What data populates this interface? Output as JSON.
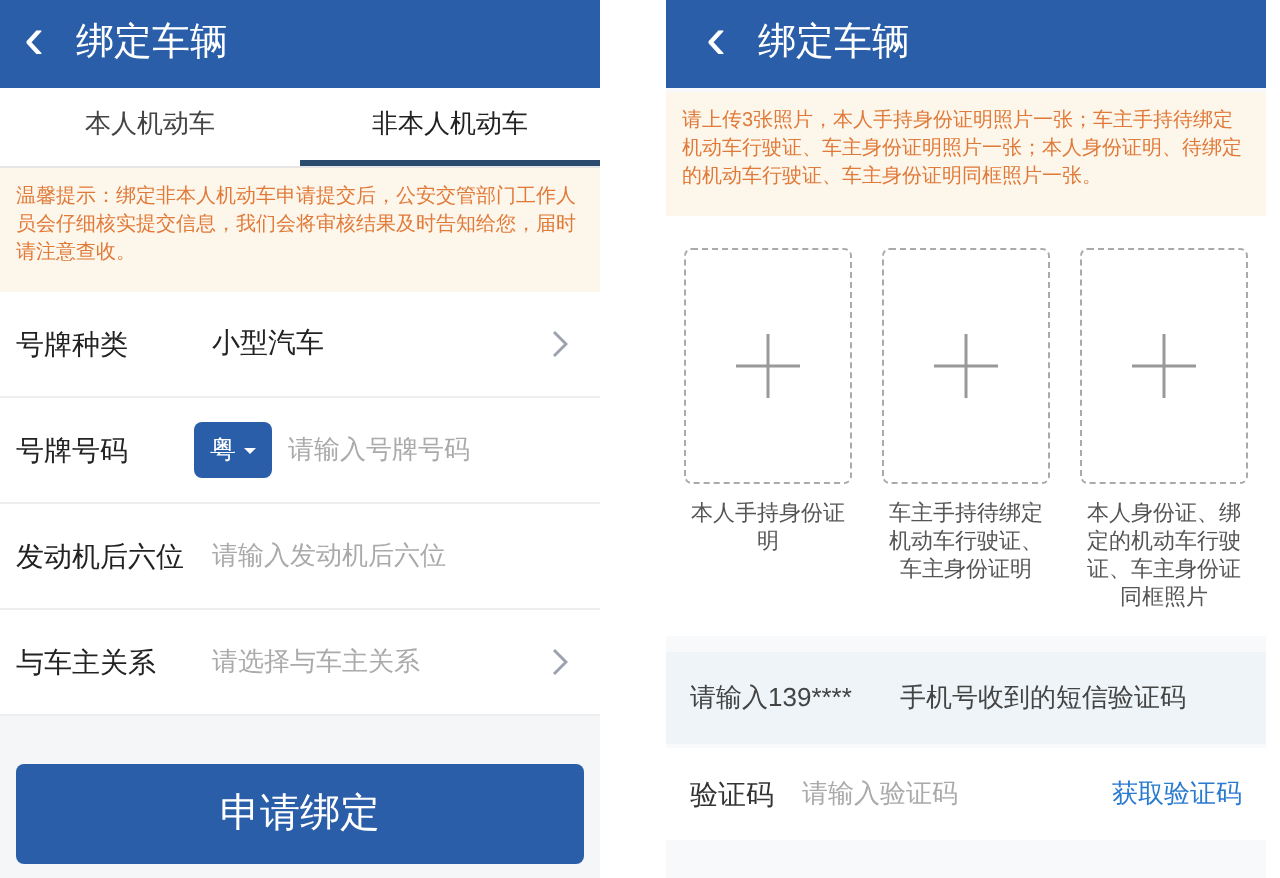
{
  "left_screen": {
    "header": {
      "back": "‹",
      "title": "绑定车辆"
    },
    "tabs": [
      {
        "label": "本人机动车",
        "selected": false
      },
      {
        "label": "非本人机动车",
        "selected": true
      }
    ],
    "notice": "温馨提示：绑定非本人机动车申请提交后，公安交管部门工作人员会仔细核实提交信息，我们会将审核结果及时告知给您，届时请注意查收。",
    "form_rows": [
      {
        "kind": "select",
        "label": "号牌种类",
        "value": "小型汽车"
      },
      {
        "kind": "plate",
        "label": "号牌号码",
        "prefix": "粤",
        "placeholder": "请输入号牌号码"
      },
      {
        "kind": "input",
        "label": "发动机后六位",
        "placeholder": "请输入发动机后六位"
      },
      {
        "kind": "select",
        "label": "与车主关系",
        "placeholder": "请选择与车主关系"
      }
    ],
    "submit_button": "申请绑定"
  },
  "right_screen": {
    "header": {
      "back": "‹",
      "title": "绑定车辆"
    },
    "notice": "请上传3张照片，本人手持身份证明照片一张；车主手持待绑定机动车行驶证、车主身份证明照片一张；本人身份证明、待绑定的机动车行驶证、车主身份证明同框照片一张。",
    "uploads": [
      {
        "caption": "本人手持身份证明"
      },
      {
        "caption": "车主手持待绑定机动车行驶证、车主身份证明"
      },
      {
        "caption": "本人身份证、绑定的机动车行驶证、车主身份证同框照片"
      }
    ],
    "sms_prompt": {
      "before": "请输入139****",
      "after": "手机号收到的短信验证码"
    },
    "code_row": {
      "label": "验证码",
      "placeholder": "请输入验证码",
      "link": "获取验证码"
    }
  }
}
